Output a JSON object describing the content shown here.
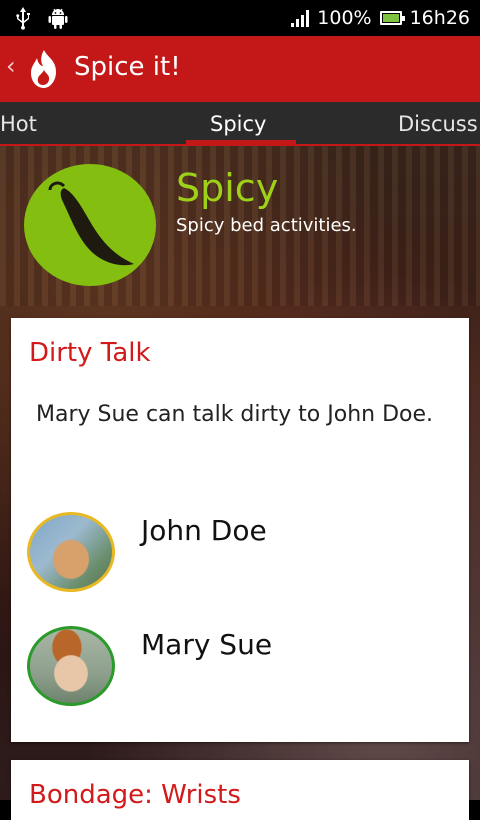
{
  "status_bar": {
    "battery_percent": "100%",
    "time": "16h26",
    "icons": [
      "usb-icon",
      "android-debug-icon",
      "signal-icon",
      "battery-icon"
    ]
  },
  "action_bar": {
    "title": "Spice it!",
    "back_icon": "chevron-left-icon",
    "logo_icon": "flame-icon",
    "color": "#c41818"
  },
  "tabs": [
    {
      "label": "Hot",
      "selected": false
    },
    {
      "label": "Spicy",
      "selected": true
    },
    {
      "label": "Discuss",
      "selected": false
    }
  ],
  "category": {
    "title": "Spicy",
    "description": "Spicy bed activities.",
    "icon": "chili-pepper-icon",
    "icon_color": "#84be10"
  },
  "cards": [
    {
      "title": "Dirty Talk",
      "text": "Mary Sue can talk dirty to John Doe.",
      "people": [
        {
          "name": "John Doe",
          "avatar_border": "#e8b922"
        },
        {
          "name": "Mary Sue",
          "avatar_border": "#2a9a2a"
        }
      ]
    },
    {
      "title": "Bondage: Wrists"
    }
  ]
}
